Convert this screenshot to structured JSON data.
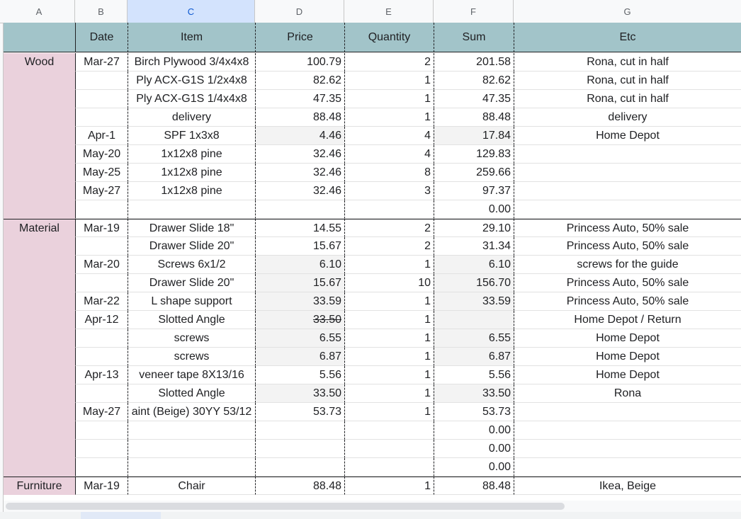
{
  "columns": [
    "A",
    "B",
    "C",
    "D",
    "E",
    "F",
    "G"
  ],
  "headers": {
    "a": "",
    "b": "Date",
    "c": "Item",
    "d": "Price",
    "e": "Quantity",
    "f": "Sum",
    "g": "Etc"
  },
  "sections": [
    {
      "name": "Wood",
      "rows": [
        {
          "b": "Mar-27",
          "c": "Birch Plywood 3/4x4x8",
          "d": "100.79",
          "e": "2",
          "f": "201.58",
          "g": "Rona, cut in half",
          "grey": false,
          "strike": false
        },
        {
          "b": "",
          "c": "Ply ACX-G1S 1/2x4x8",
          "d": "82.62",
          "e": "1",
          "f": "82.62",
          "g": "Rona, cut in half",
          "grey": false,
          "strike": false
        },
        {
          "b": "",
          "c": "Ply ACX-G1S 1/4x4x8",
          "d": "47.35",
          "e": "1",
          "f": "47.35",
          "g": "Rona, cut in half",
          "grey": false,
          "strike": false
        },
        {
          "b": "",
          "c": "delivery",
          "d": "88.48",
          "e": "1",
          "f": "88.48",
          "g": "delivery",
          "grey": false,
          "strike": false
        },
        {
          "b": "Apr-1",
          "c": "SPF 1x3x8",
          "d": "4.46",
          "e": "4",
          "f": "17.84",
          "g": "Home Depot",
          "grey": true,
          "strike": false
        },
        {
          "b": "May-20",
          "c": "1x12x8 pine",
          "d": "32.46",
          "e": "4",
          "f": "129.83",
          "g": "",
          "grey": false,
          "strike": false
        },
        {
          "b": "May-25",
          "c": "1x12x8 pine",
          "d": "32.46",
          "e": "8",
          "f": "259.66",
          "g": "",
          "grey": false,
          "strike": false
        },
        {
          "b": "May-27",
          "c": "1x12x8 pine",
          "d": "32.46",
          "e": "3",
          "f": "97.37",
          "g": "",
          "grey": false,
          "strike": false
        },
        {
          "b": "",
          "c": "",
          "d": "",
          "e": "",
          "f": "0.00",
          "g": "",
          "grey": false,
          "strike": false
        }
      ]
    },
    {
      "name": "Material",
      "rows": [
        {
          "b": "Mar-19",
          "c": "Drawer Slide 18\"",
          "d": "14.55",
          "e": "2",
          "f": "29.10",
          "g": "Princess Auto, 50% sale",
          "grey": false,
          "strike": false
        },
        {
          "b": "",
          "c": "Drawer Slide 20\"",
          "d": "15.67",
          "e": "2",
          "f": "31.34",
          "g": "Princess Auto, 50% sale",
          "grey": false,
          "strike": false
        },
        {
          "b": "Mar-20",
          "c": "Screws 6x1/2",
          "d": "6.10",
          "e": "1",
          "f": "6.10",
          "g": "screws for the guide",
          "grey": true,
          "strike": false
        },
        {
          "b": "",
          "c": "Drawer Slide 20\"",
          "d": "15.67",
          "e": "10",
          "f": "156.70",
          "g": "Princess Auto, 50% sale",
          "grey": true,
          "strike": false
        },
        {
          "b": "Mar-22",
          "c": "L shape support",
          "d": "33.59",
          "e": "1",
          "f": "33.59",
          "g": "Princess Auto, 50% sale",
          "grey": true,
          "strike": false
        },
        {
          "b": "Apr-12",
          "c": "Slotted Angle",
          "d": "33.50",
          "e": "1",
          "f": "",
          "g": "Home Depot / Return",
          "grey": true,
          "strike": true
        },
        {
          "b": "",
          "c": "screws",
          "d": "6.55",
          "e": "1",
          "f": "6.55",
          "g": "Home Depot",
          "grey": true,
          "strike": false
        },
        {
          "b": "",
          "c": "screws",
          "d": "6.87",
          "e": "1",
          "f": "6.87",
          "g": "Home Depot",
          "grey": true,
          "strike": false
        },
        {
          "b": "Apr-13",
          "c": "veneer tape 8X13/16",
          "d": "5.56",
          "e": "1",
          "f": "5.56",
          "g": "Home Depot",
          "grey": false,
          "strike": false
        },
        {
          "b": "",
          "c": "Slotted Angle",
          "d": "33.50",
          "e": "1",
          "f": "33.50",
          "g": "Rona",
          "grey": true,
          "strike": false
        },
        {
          "b": "May-27",
          "c": "aint (Beige) 30YY 53/12",
          "d": "53.73",
          "e": "1",
          "f": "53.73",
          "g": "",
          "grey": false,
          "strike": false
        },
        {
          "b": "",
          "c": "",
          "d": "",
          "e": "",
          "f": "0.00",
          "g": "",
          "grey": false,
          "strike": false
        },
        {
          "b": "",
          "c": "",
          "d": "",
          "e": "",
          "f": "0.00",
          "g": "",
          "grey": false,
          "strike": false
        },
        {
          "b": "",
          "c": "",
          "d": "",
          "e": "",
          "f": "0.00",
          "g": "",
          "grey": false,
          "strike": false
        }
      ]
    },
    {
      "name": "Furniture",
      "rows": [
        {
          "b": "Mar-19",
          "c": "Chair",
          "d": "88.48",
          "e": "1",
          "f": "88.48",
          "g": "Ikea, Beige",
          "grey": false,
          "strike": false
        }
      ]
    }
  ],
  "colors": {
    "header_bg": "#a2c4c9",
    "category_bg": "#ead1dc",
    "selected_col_bg": "#d3e3fd",
    "grey_cell": "#f3f3f3"
  }
}
